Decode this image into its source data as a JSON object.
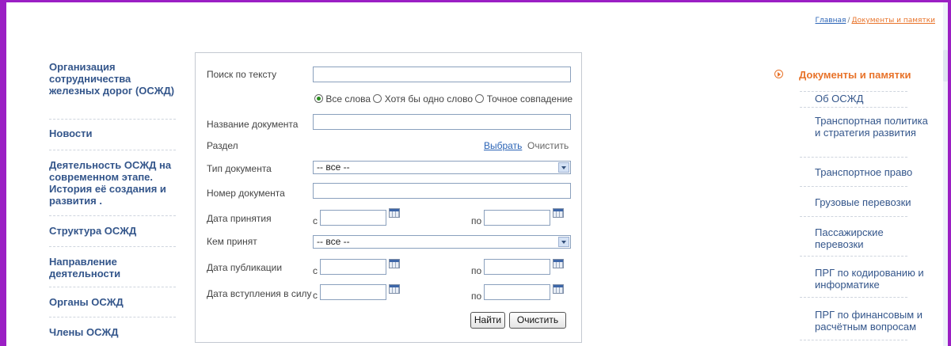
{
  "breadcrumb": {
    "home": "Главная",
    "separator": "/",
    "current": "Документы и памятки"
  },
  "left_nav": [
    "Организация сотрудничества железных дорог (ОСЖД)",
    "Новости",
    "Деятельность ОСЖД на современном этапе. История её создания и развития .",
    "Структура ОСЖД",
    "Направление деятельности",
    "Органы ОСЖД",
    "Члены ОСЖД"
  ],
  "search": {
    "text_label": "Поиск по тексту",
    "text_value": "",
    "radio_all": "Все слова",
    "radio_any": "Хотя бы одно слово",
    "radio_exact": "Точное совпадение",
    "radio_selected": "Все слова",
    "name_label": "Название документа",
    "section_label": "Раздел",
    "section_select": "Выбрать",
    "section_clear": "Очистить",
    "type_label": "Тип документа",
    "type_value": "-- все --",
    "number_label": "Номер документа",
    "date_accepted_label": "Дата принятия",
    "from": "с",
    "to": "по",
    "accepted_by_label": "Кем принят",
    "accepted_by_value": "-- все --",
    "date_published_label": "Дата публикации",
    "date_effective_label": "Дата вступления в силу",
    "find_button": "Найти",
    "clear_button": "Очистить"
  },
  "right_nav": {
    "heading": "Документы и памятки",
    "items": [
      "Об ОСЖД",
      "Транспортная политика и стратегия развития",
      "Транспортное право",
      "Грузовые перевозки",
      "Пассажирские перевозки",
      "ПРГ по кодированию и информатике",
      "ПРГ по финансовым и расчётным вопросам"
    ]
  },
  "colors": {
    "frame": "#9b1fc4",
    "link": "#2b64b6",
    "accent": "#e8732a",
    "nav": "#34568b"
  }
}
